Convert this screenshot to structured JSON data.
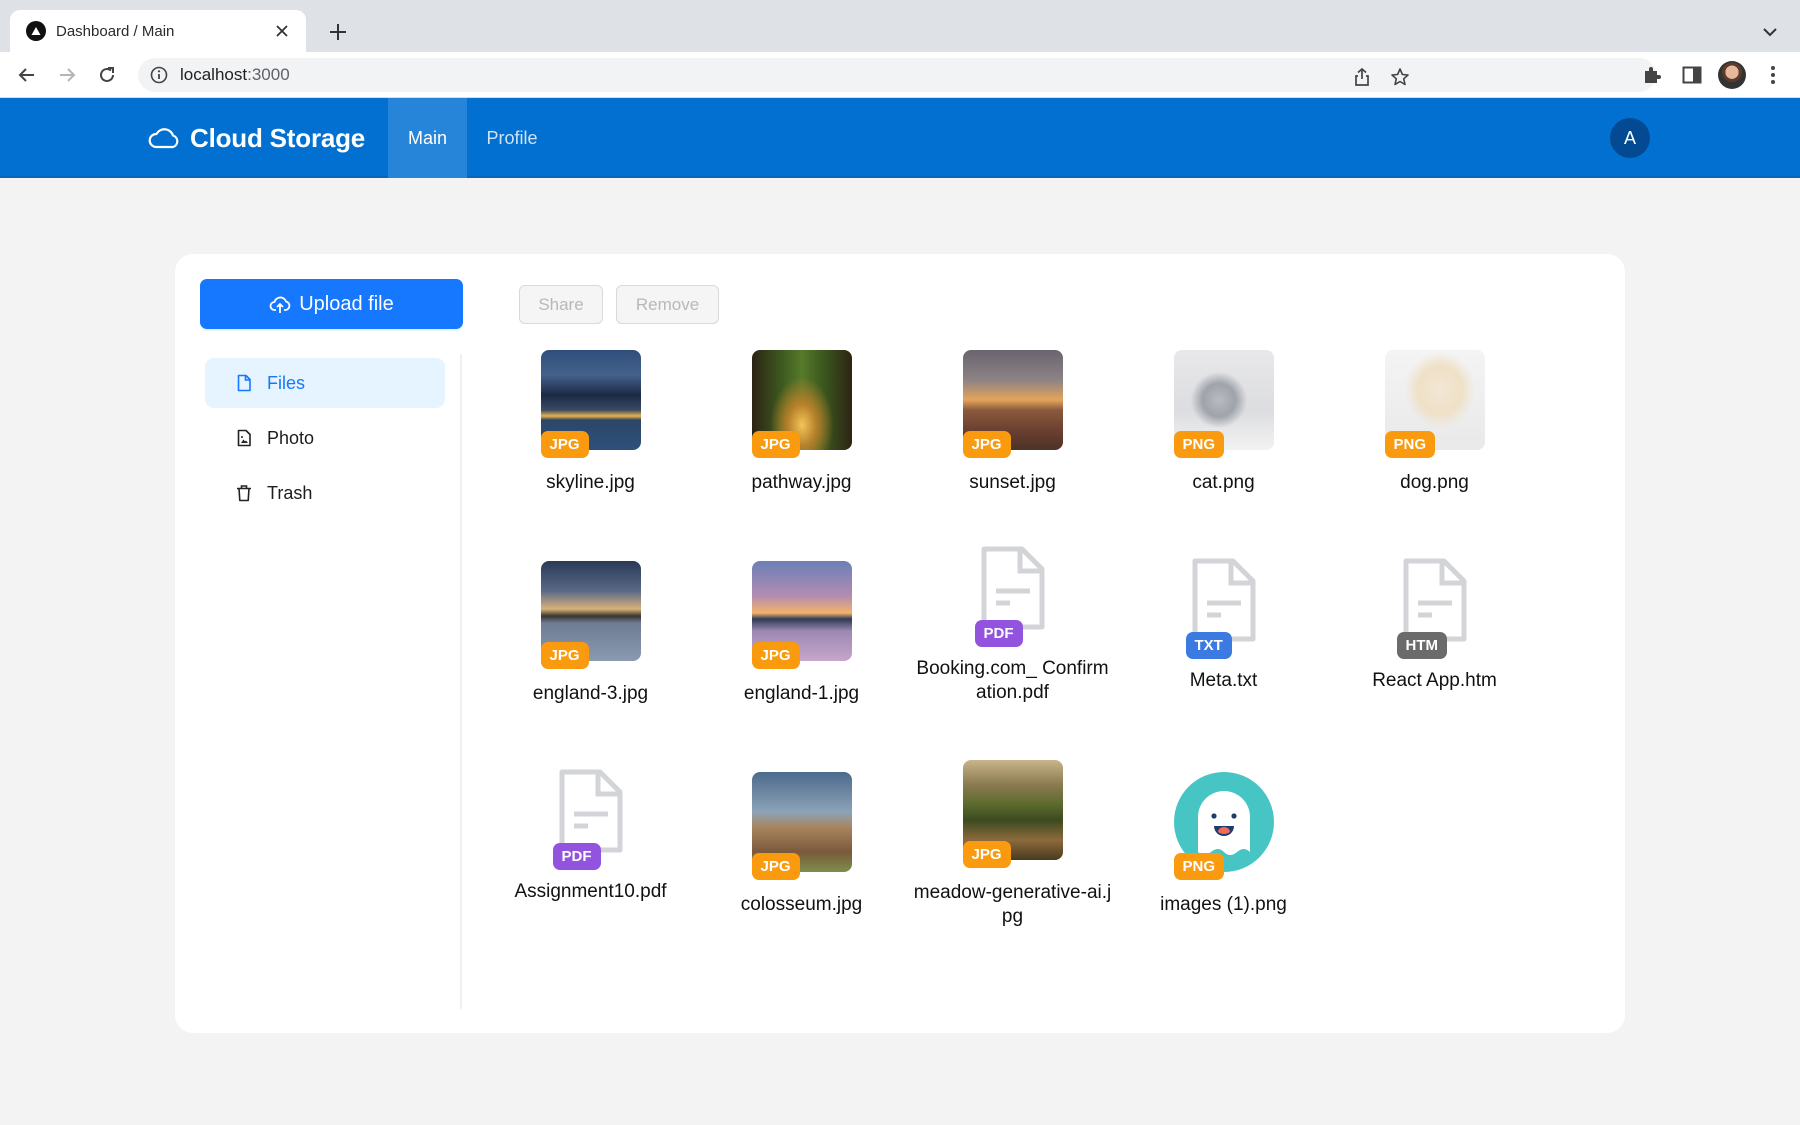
{
  "browser": {
    "tab_title": "Dashboard / Main",
    "url_host": "localhost",
    "url_port": ":3000"
  },
  "app": {
    "brand": "Cloud Storage",
    "nav": [
      {
        "label": "Main",
        "active": true
      },
      {
        "label": "Profile",
        "active": false
      }
    ],
    "avatar_initial": "A",
    "colors": {
      "header": "#0270d1",
      "primary": "#1677ff",
      "badge_jpg": "#fa9a0f",
      "badge_png": "#fa9a0f",
      "badge_pdf": "#9254de",
      "badge_txt": "#3b7ae0",
      "badge_htm": "#6b6b6b"
    }
  },
  "toolbar": {
    "upload_label": "Upload file",
    "share_label": "Share",
    "remove_label": "Remove"
  },
  "sidebar": {
    "items": [
      {
        "label": "Files",
        "icon": "file-icon",
        "active": true
      },
      {
        "label": "Photo",
        "icon": "file-image-icon",
        "active": false
      },
      {
        "label": "Trash",
        "icon": "trash-icon",
        "active": false
      }
    ]
  },
  "files": [
    {
      "name": "skyline.jpg",
      "type": "JPG",
      "kind": "image",
      "thumb": "skyline"
    },
    {
      "name": "pathway.jpg",
      "type": "JPG",
      "kind": "image",
      "thumb": "pathway"
    },
    {
      "name": "sunset.jpg",
      "type": "JPG",
      "kind": "image",
      "thumb": "sunset"
    },
    {
      "name": "cat.png",
      "type": "PNG",
      "kind": "image",
      "thumb": "cat"
    },
    {
      "name": "dog.png",
      "type": "PNG",
      "kind": "image",
      "thumb": "dog"
    },
    {
      "name": "england-3.jpg",
      "type": "JPG",
      "kind": "image",
      "thumb": "england3"
    },
    {
      "name": "england-1.jpg",
      "type": "JPG",
      "kind": "image",
      "thumb": "england1"
    },
    {
      "name": "Booking.com_ Confirmation.pdf",
      "type": "PDF",
      "kind": "doc"
    },
    {
      "name": "Meta.txt",
      "type": "TXT",
      "kind": "doc"
    },
    {
      "name": "React App.htm",
      "type": "HTM",
      "kind": "doc"
    },
    {
      "name": "Assignment10.pdf",
      "type": "PDF",
      "kind": "doc"
    },
    {
      "name": "colosseum.jpg",
      "type": "JPG",
      "kind": "image",
      "thumb": "colosseum"
    },
    {
      "name": "meadow-generative-ai.jpg",
      "type": "JPG",
      "kind": "image",
      "thumb": "meadow"
    },
    {
      "name": "images (1).png",
      "type": "PNG",
      "kind": "image",
      "thumb": "ghost"
    }
  ]
}
